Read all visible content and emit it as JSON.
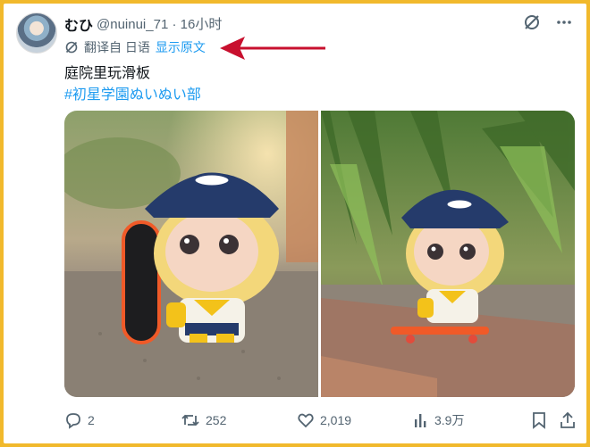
{
  "author": {
    "display_name": "むひ",
    "handle": "@nuinui_71",
    "separator": "·",
    "time": "16小时"
  },
  "translation": {
    "prefix": "翻译自 日语",
    "show_original": "显示原文"
  },
  "post": {
    "text": "庭院里玩滑板",
    "hashtag": "#初星学園ぬいぬい部"
  },
  "metrics": {
    "replies": "2",
    "reposts": "252",
    "likes": "2,019",
    "views": "3.9万"
  },
  "colors": {
    "frame": "#f1b92c",
    "accent_link": "#1d9bf0",
    "annotation_arrow": "#c8102e",
    "muted_text": "#536471"
  },
  "icons": [
    "grok-icon",
    "more-icon",
    "translate-icon",
    "reply-icon",
    "repost-icon",
    "like-icon",
    "views-icon",
    "bookmark-icon",
    "share-icon"
  ]
}
